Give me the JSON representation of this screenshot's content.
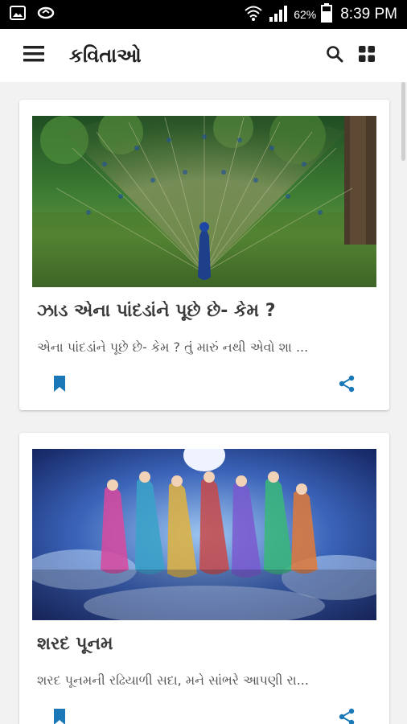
{
  "status_bar": {
    "left_icons": [
      "image-notification-icon",
      "watch-notification-icon"
    ],
    "right_icons": [
      "wifi-icon",
      "signal-icon",
      "battery-icon"
    ],
    "battery": "62%",
    "time": "8:39 PM"
  },
  "toolbar": {
    "title": "કવિતાઓ",
    "menu_icon": "hamburger-menu-icon",
    "search_icon": "search-icon",
    "grid_icon": "grid-view-icon"
  },
  "cards": [
    {
      "title": "ઝાડ એના પાંદડાંને પૂછે છે- કેમ ?",
      "description": "એના પાંદડાંને પૂછે છે- કેમ ? તું મારું નથી એવો શા ...",
      "image": "peacock-photo",
      "bookmark_icon": "bookmark-icon",
      "share_icon": "share-icon"
    },
    {
      "title": "શરદ પૂનમ",
      "description": "શરદ પૂનમની રઢિયાળી સદા, મને સાંભરે આપણી રા...",
      "image": "garba-dance-painting",
      "bookmark_icon": "bookmark-icon",
      "share_icon": "share-icon"
    }
  ],
  "colors": {
    "accent": "#1a78b6",
    "title_text": "#3a3a3a",
    "background": "#f2f2f2"
  }
}
